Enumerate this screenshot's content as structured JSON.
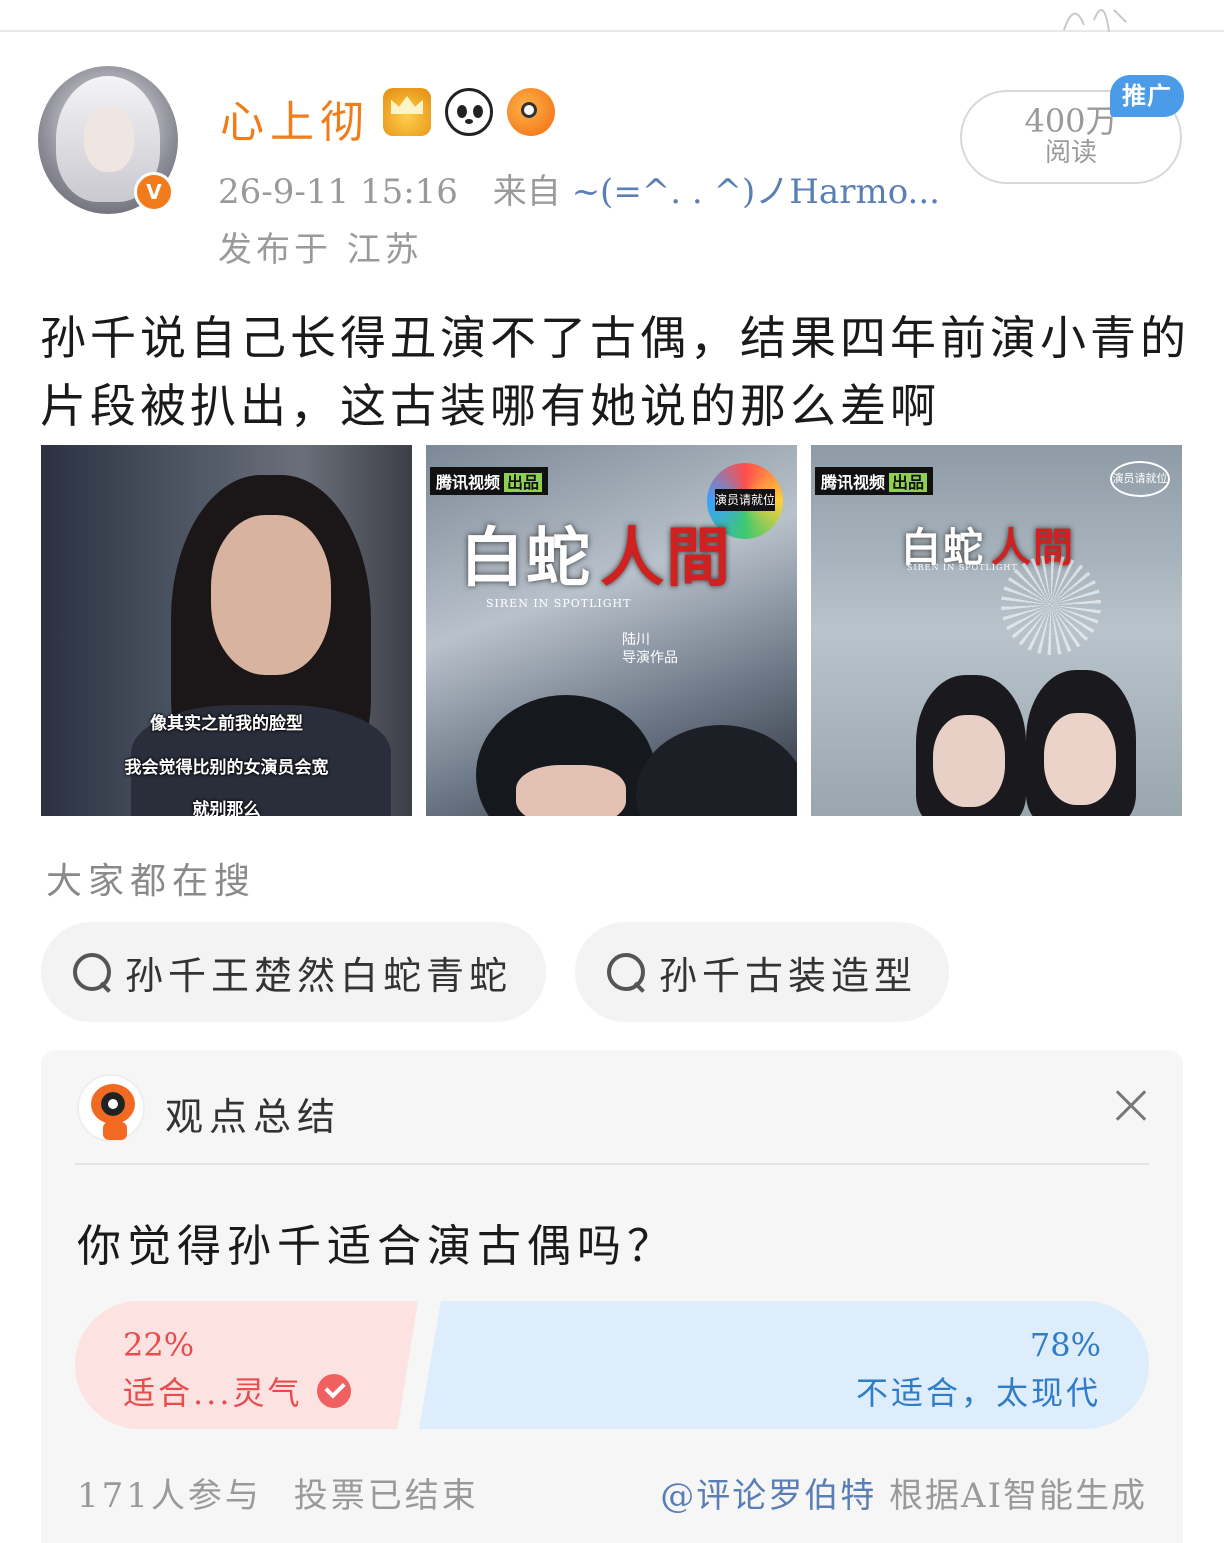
{
  "post": {
    "author": "心上彻",
    "time": "26-9-11 15:16",
    "source_prefix": "来自",
    "source_name": "~(=^. . ^)ノHarmo...",
    "location": "发布于 江苏",
    "reads_num": "400万",
    "reads_label": "阅读",
    "promo": "推广",
    "text": "孙千说自己长得丑演不了古偶，结果四年前演小青的片段被扒出，这古装哪有她说的那么差啊",
    "badges": [
      "crown-icon",
      "panda-icon",
      "fish-icon"
    ]
  },
  "images": {
    "img1_subtitles": [
      "像其实之前我的脸型",
      "我会觉得比别的女演员会宽",
      "就别那么"
    ],
    "tencent_label": "腾讯视频",
    "tencent_out": "出品",
    "studio_logo": "演员请就位",
    "poster_title_white": "白蛇",
    "poster_title_red": "人間",
    "poster_en": "SIREN IN SPOTLIGHT",
    "poster_director": "陆川",
    "poster_director_sub": "导演作品"
  },
  "search": {
    "title": "大家都在搜",
    "chips": [
      "孙千王楚然白蛇青蛇",
      "孙千古装造型"
    ]
  },
  "summary": {
    "title": "观点总结",
    "question": "你觉得孙千适合演古偶吗？",
    "option_left_pct": "22%",
    "option_left_label": "适合...灵气",
    "option_right_pct": "78%",
    "option_right_label": "不适合，太现代",
    "participants": "171人参与",
    "status": "投票已结束",
    "credit_at": "@评论罗伯特",
    "credit_text": "根据AI智能生成"
  },
  "colors": {
    "username": "#f07d1a",
    "left_option": "#e84c4c",
    "right_option": "#2f7cc9",
    "promo": "#4a9ce8"
  }
}
